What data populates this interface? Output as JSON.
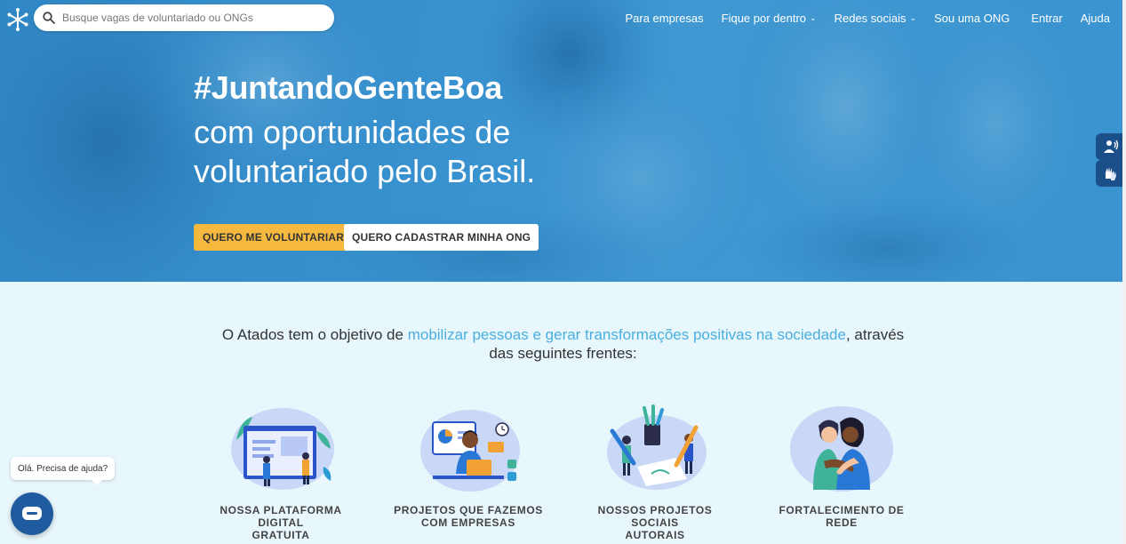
{
  "header": {
    "search_placeholder": "Busque vagas de voluntariado ou ONGs",
    "nav": [
      {
        "label": "Para empresas",
        "dropdown": false
      },
      {
        "label": "Fique por dentro",
        "dropdown": true
      },
      {
        "label": "Redes sociais",
        "dropdown": true
      },
      {
        "label": "Sou uma ONG",
        "dropdown": false
      },
      {
        "label": "Entrar",
        "dropdown": false
      },
      {
        "label": "Ajuda",
        "dropdown": false
      }
    ]
  },
  "hero": {
    "hashtag": "#JuntandoGenteBoa",
    "subtitle": "com oportunidades de voluntariado pelo Brasil.",
    "primary_button": "QUERO ME VOLUNTARIAR",
    "secondary_button": "QUERO CADASTRAR MINHA ONG"
  },
  "mission": {
    "before": "O Atados tem o objetivo de ",
    "highlight": "mobilizar pessoas e gerar transformações positivas na sociedade",
    "after_line1": ", através",
    "line2": "das seguintes frentes:"
  },
  "fronts": [
    {
      "line1": "NOSSA PLATAFORMA DIGITAL",
      "line2": "GRATUITA",
      "icon": "platform-illustration"
    },
    {
      "line1": "PROJETOS QUE FAZEMOS",
      "line2": "COM EMPRESAS",
      "icon": "companies-illustration"
    },
    {
      "line1": "NOSSOS PROJETOS SOCIAIS",
      "line2": "AUTORAIS",
      "icon": "social-projects-illustration"
    },
    {
      "line1": "FORTALECIMENTO DE REDE",
      "line2": "",
      "icon": "network-illustration"
    }
  ],
  "chat": {
    "bubble": "Olá. Precisa de ajuda?"
  },
  "colors": {
    "accent": "#4aaee0",
    "primary_button": "#f6b93f",
    "chat": "#1f5b9e",
    "section_bg": "#e8f7fc"
  }
}
